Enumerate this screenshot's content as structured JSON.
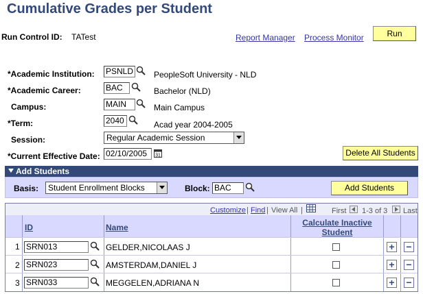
{
  "page": {
    "title": "Cumulative Grades per Student"
  },
  "run_control": {
    "label": "Run Control ID:",
    "value": "TATest"
  },
  "links": {
    "report_manager": "Report Manager",
    "process_monitor": "Process Monitor"
  },
  "run_button": "Run",
  "form": {
    "academic_institution": {
      "label": "*Academic Institution:",
      "value": "PSNLD",
      "description": "PeopleSoft University -  NLD"
    },
    "academic_career": {
      "label": "*Academic Career:",
      "value": "BAC",
      "description": "Bachelor (NLD)"
    },
    "campus": {
      "label": "Campus:",
      "value": "MAIN",
      "description": "Main Campus"
    },
    "term": {
      "label": "*Term:",
      "value": "2040",
      "description": "Acad year 2004-2005"
    },
    "session": {
      "label": "Session:",
      "value": "Regular Academic Session"
    },
    "effective_date": {
      "label": "*Current Effective Date:",
      "value": "02/10/2005"
    }
  },
  "delete_all_button": "Delete All Students",
  "add_students": {
    "section_title": "Add Students",
    "basis_label": "Basis:",
    "basis_value": "Student Enrollment Blocks",
    "block_label": "Block:",
    "block_value": "BAC",
    "add_button": "Add Students"
  },
  "grid": {
    "nav": {
      "customize": "Customize",
      "sep1": "|",
      "find": "Find",
      "sep2": "|",
      "view_all": "View All",
      "sep3": "|",
      "first": "First",
      "range": "1-3 of 3",
      "last": "Last"
    },
    "headers": {
      "id": "ID",
      "name": "Name",
      "calc_line1": "Calculate Inactive",
      "calc_line2": "Student"
    },
    "rows": [
      {
        "num": "1",
        "id": "SRN013",
        "name": "GELDER,NICOLAAS J"
      },
      {
        "num": "2",
        "id": "SRN023",
        "name": "AMSTERDAM,DANIEL J"
      },
      {
        "num": "3",
        "id": "SRN033",
        "name": "MEGGELEN,ADRIANA N"
      }
    ],
    "add_symbol": "+",
    "remove_symbol": "−"
  },
  "colors": {
    "title": "#33497a",
    "button": "#ffff9d",
    "section": "#33497a",
    "grid_header": "#d9d9ff"
  }
}
